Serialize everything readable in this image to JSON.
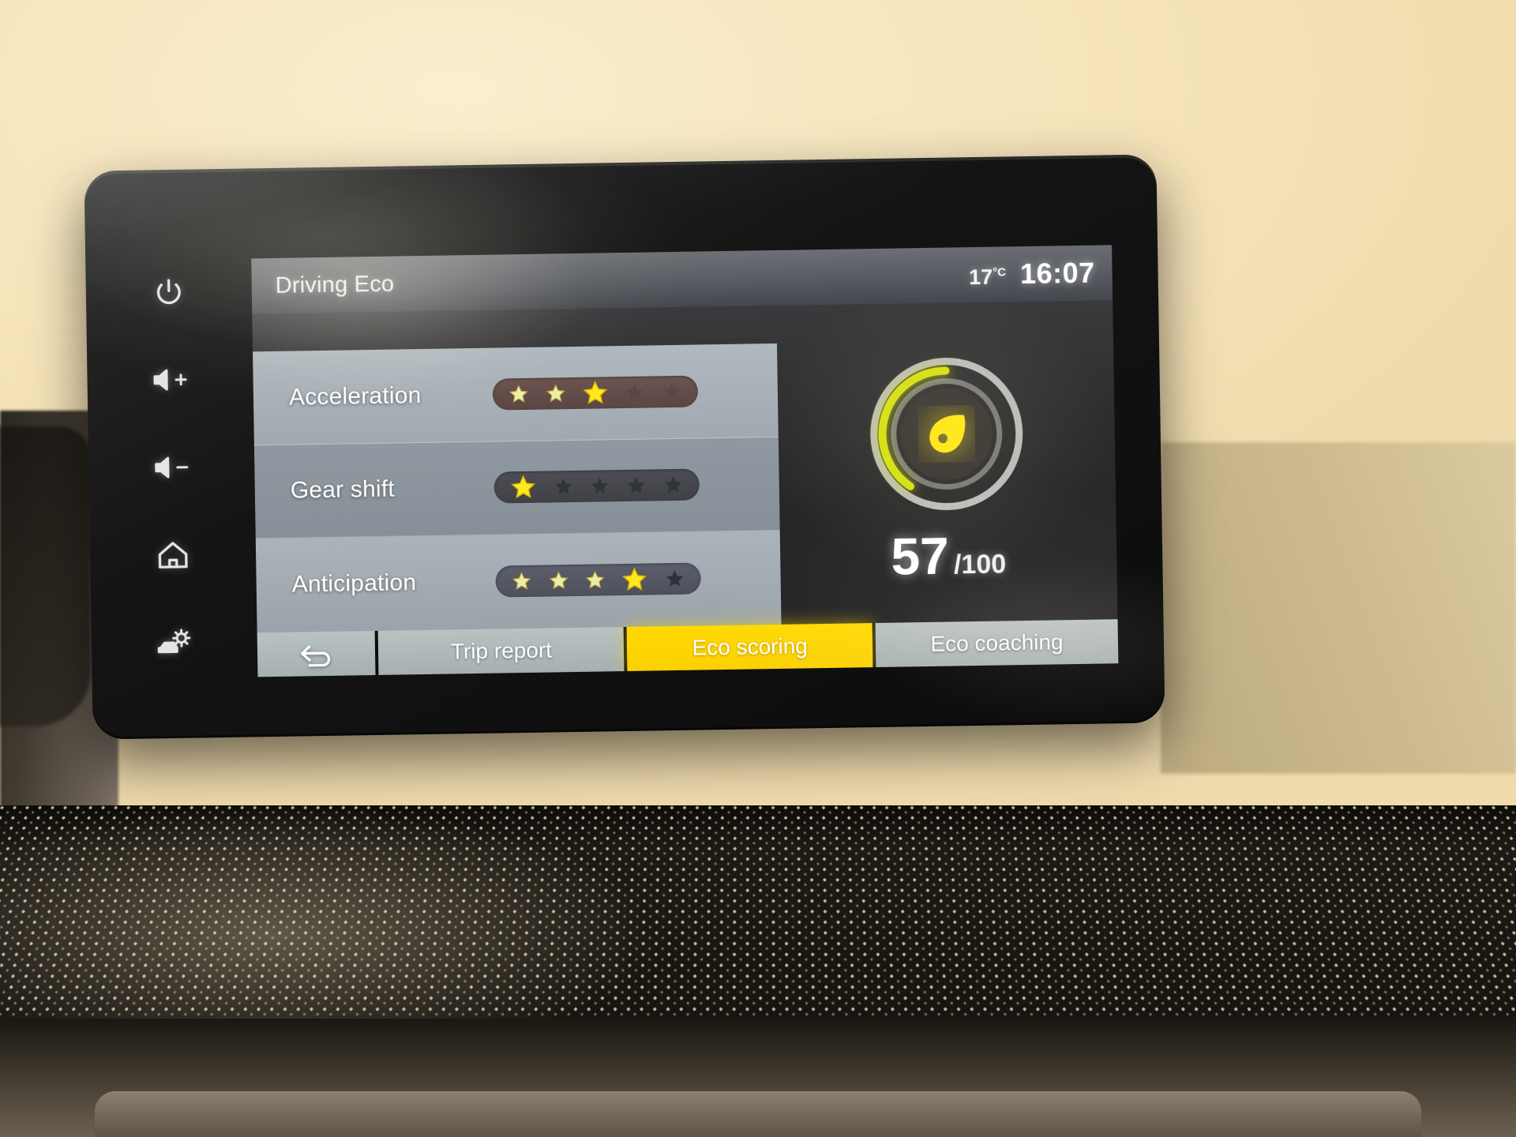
{
  "device": {
    "hardware_keys": [
      {
        "name": "power-key",
        "icon": "power-icon"
      },
      {
        "name": "volume-up-key",
        "icon": "volume-up-icon"
      },
      {
        "name": "volume-down-key",
        "icon": "volume-down-icon"
      },
      {
        "name": "home-key",
        "icon": "home-icon"
      },
      {
        "name": "vehicle-settings-key",
        "icon": "car-gear-icon"
      }
    ]
  },
  "header": {
    "title": "Driving Eco",
    "temperature": "17",
    "temperature_unit": "°C",
    "clock": "16:07"
  },
  "scores": {
    "max_stars": 5,
    "rows": [
      {
        "label": "Acceleration",
        "stars": 3,
        "track_tone": "warm"
      },
      {
        "label": "Gear shift",
        "stars": 1,
        "track_tone": "cool"
      },
      {
        "label": "Anticipation",
        "stars": 4,
        "track_tone": "slate"
      }
    ]
  },
  "gauge": {
    "score": "57",
    "max_label": "/100",
    "score_value": 57,
    "score_max": 100,
    "icon": "leaf-icon",
    "arc_color": "#d8e21a",
    "ring_color": "#c9cbc6"
  },
  "tabs": {
    "back_icon": "back-arrow-icon",
    "items": [
      {
        "label": "Trip report",
        "active": false
      },
      {
        "label": "Eco scoring",
        "active": true
      },
      {
        "label": "Eco coaching",
        "active": false
      }
    ]
  },
  "colors": {
    "accent_yellow": "#ffd900",
    "star_bright": "#ffe81f",
    "star_pale": "#e8f0a8",
    "star_empty": "#3a3b41"
  }
}
